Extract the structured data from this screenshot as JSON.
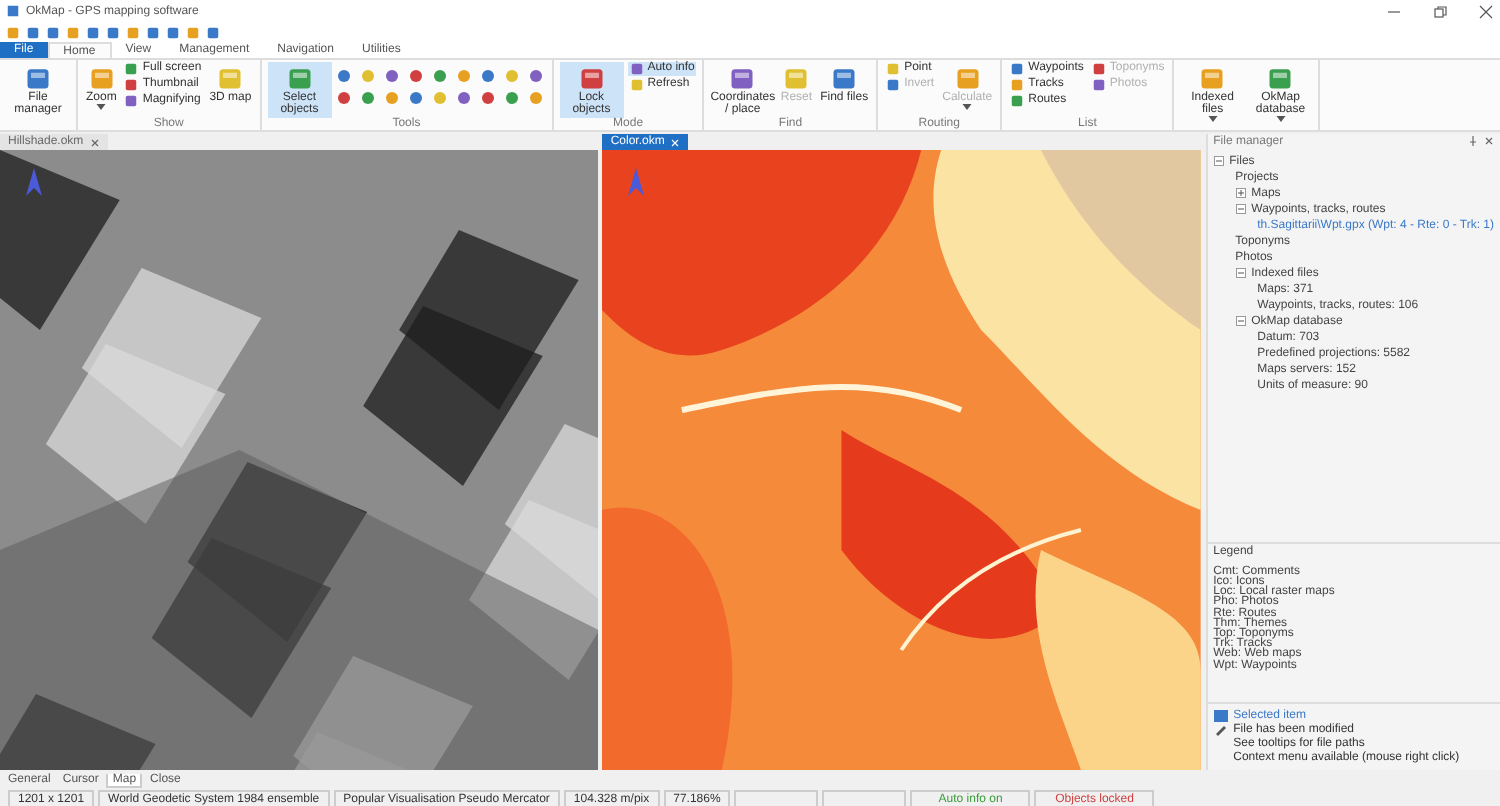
{
  "window": {
    "title": "OkMap - GPS mapping software"
  },
  "ribbon_tabs": [
    {
      "label": "File",
      "selected": false,
      "kind": "file"
    },
    {
      "label": "Home",
      "selected": true,
      "kind": "tab"
    },
    {
      "label": "View",
      "selected": false,
      "kind": "tab"
    },
    {
      "label": "Management",
      "selected": false,
      "kind": "tab"
    },
    {
      "label": "Navigation",
      "selected": false,
      "kind": "tab"
    },
    {
      "label": "Utilities",
      "selected": false,
      "kind": "tab"
    }
  ],
  "ribbon_groups": [
    {
      "items": [
        {
          "label": "File manager",
          "kind": "large",
          "selected": false,
          "disabled": false
        }
      ]
    },
    {
      "label": "Show",
      "items": [
        {
          "label": "Zoom",
          "kind": "large",
          "selected": false,
          "disabled": false,
          "dropdown": true
        },
        {
          "label": "Full screen",
          "kind": "small",
          "selected": false,
          "disabled": false
        },
        {
          "label": "Thumbnail",
          "kind": "small",
          "selected": false,
          "disabled": false
        },
        {
          "label": "Magnifying",
          "kind": "small",
          "selected": false,
          "disabled": false
        },
        {
          "label": "3D map",
          "kind": "large",
          "selected": false,
          "disabled": false
        }
      ]
    },
    {
      "label": "Tools",
      "items": [
        {
          "label": "Select objects",
          "kind": "large",
          "selected": true,
          "disabled": false
        },
        {
          "kind": "tools"
        }
      ]
    },
    {
      "label": "Mode",
      "items": [
        {
          "label": "Lock objects",
          "kind": "large",
          "selected": true,
          "disabled": false
        },
        {
          "label": "Auto info",
          "kind": "small",
          "selected": true,
          "disabled": false
        },
        {
          "label": "Refresh",
          "kind": "small",
          "selected": false,
          "disabled": false
        }
      ]
    },
    {
      "label": "Find",
      "items": [
        {
          "label": "Coordinates / place",
          "kind": "large",
          "selected": false,
          "disabled": false
        },
        {
          "label": "Reset",
          "kind": "large",
          "selected": false,
          "disabled": true
        },
        {
          "label": "Find files",
          "kind": "large",
          "selected": false,
          "disabled": false
        }
      ]
    },
    {
      "label": "Routing",
      "items": [
        {
          "label": "Point",
          "kind": "small",
          "selected": false,
          "disabled": false
        },
        {
          "label": "Invert",
          "kind": "small",
          "selected": false,
          "disabled": true
        },
        {
          "label": "Calculate",
          "kind": "large",
          "selected": false,
          "disabled": true,
          "dropdown": true
        }
      ]
    },
    {
      "label": "List",
      "items": [
        {
          "label": "Waypoints",
          "kind": "small",
          "selected": false,
          "disabled": false
        },
        {
          "label": "Tracks",
          "kind": "small",
          "selected": false,
          "disabled": false
        },
        {
          "label": "Routes",
          "kind": "small",
          "selected": false,
          "disabled": false
        },
        {
          "label": "Toponyms",
          "kind": "small",
          "selected": false,
          "disabled": true
        },
        {
          "label": "Photos",
          "kind": "small",
          "selected": false,
          "disabled": true
        }
      ]
    },
    {
      "items": [
        {
          "label": "Indexed files",
          "kind": "large",
          "selected": false,
          "disabled": false,
          "dropdown": true
        },
        {
          "label": "OkMap database",
          "kind": "large",
          "selected": false,
          "disabled": false,
          "dropdown": true
        }
      ]
    }
  ],
  "documents": [
    {
      "title": "Hillshade.okm",
      "selected": false,
      "kind": "hillshade"
    },
    {
      "title": "Color.okm",
      "selected": true,
      "kind": "color"
    }
  ],
  "file_manager": {
    "title": "File manager",
    "tree": [
      {
        "label": "Files",
        "expanded": true,
        "selected": false,
        "children": [
          {
            "label": "Projects",
            "selected": false
          },
          {
            "label": "Maps",
            "expanded": false,
            "selected": false
          },
          {
            "label": "Waypoints, tracks, routes",
            "expanded": true,
            "selected": false,
            "children": [
              {
                "label": "th.Sagittarii\\Wpt.gpx (Wpt: 4 - Rte: 0 - Trk: 1)",
                "selected": true
              }
            ]
          },
          {
            "label": "Toponyms",
            "selected": false
          },
          {
            "label": "Photos",
            "selected": false
          },
          {
            "label": "Indexed files",
            "expanded": true,
            "selected": false,
            "children": [
              {
                "label": "Maps: 371",
                "selected": false
              },
              {
                "label": "Waypoints, tracks, routes: 106",
                "selected": false
              }
            ]
          },
          {
            "label": "OkMap database",
            "expanded": true,
            "selected": false,
            "children": [
              {
                "label": "Datum: 703",
                "selected": false
              },
              {
                "label": "Predefined projections: 5582",
                "selected": false
              },
              {
                "label": "Maps servers: 152",
                "selected": false
              },
              {
                "label": "Units of measure: 90",
                "selected": false
              }
            ]
          }
        ]
      }
    ]
  },
  "legend": {
    "title": "Legend",
    "entries": [
      "Cmt: Comments",
      "Ico: Icons",
      "Loc: Local raster maps",
      "Pho: Photos",
      "Rte: Routes",
      "Thm: Themes",
      "Top: Toponyms",
      "Trk: Tracks",
      "Web: Web maps",
      "Wpt: Waypoints"
    ]
  },
  "notes": [
    {
      "kind": "selected",
      "text": "Selected item"
    },
    {
      "kind": "modified",
      "text": "File has been modified"
    },
    {
      "kind": "plain",
      "text": "See tooltips for file paths"
    },
    {
      "kind": "plain",
      "text": "Context menu available (mouse right click)"
    }
  ],
  "bottom_tabs": [
    {
      "label": "General",
      "selected": false
    },
    {
      "label": "Cursor",
      "selected": false
    },
    {
      "label": "Map",
      "selected": true
    },
    {
      "label": "Close",
      "selected": false
    }
  ],
  "status_bar": [
    {
      "text": "1201 x 1201",
      "color": "#333333"
    },
    {
      "text": "World Geodetic System 1984 ensemble",
      "color": "#333333"
    },
    {
      "text": "Popular Visualisation Pseudo Mercator",
      "color": "#333333"
    },
    {
      "text": "104.328 m/pix",
      "color": "#333333"
    },
    {
      "text": "77.186%",
      "color": "#333333"
    },
    {
      "text": "Auto info on",
      "color": "#3a9a3a"
    },
    {
      "text": "Objects locked",
      "color": "#d04040"
    }
  ]
}
